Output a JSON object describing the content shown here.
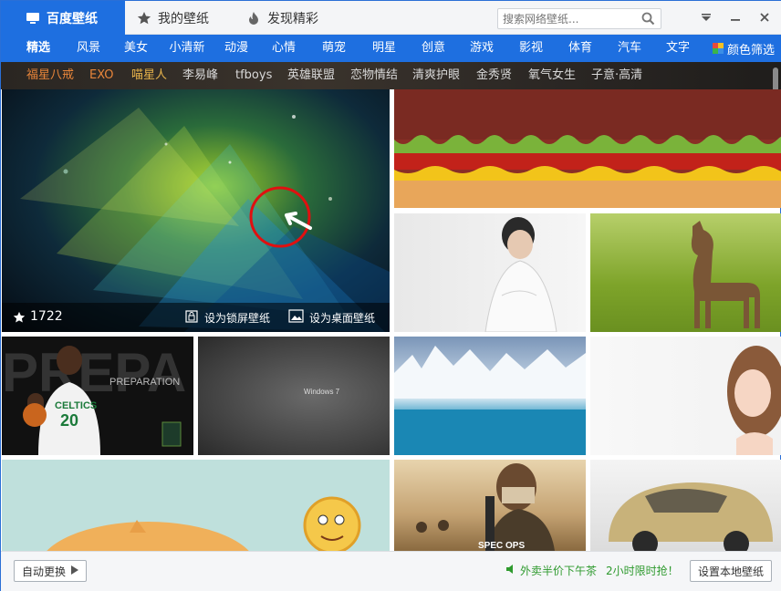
{
  "tabs": {
    "home": "百度壁纸",
    "mine": "我的壁纸",
    "discover": "发现精彩"
  },
  "search": {
    "placeholder": "搜索网络壁纸..."
  },
  "categories": [
    "精选",
    "风景",
    "美女",
    "小清新",
    "动漫",
    "心情",
    "萌宠",
    "明星",
    "创意",
    "游戏",
    "影视",
    "体育",
    "汽车",
    "文字"
  ],
  "color_filter": "颜色筛选",
  "tags": [
    "福星八戒",
    "EXO",
    "喵星人",
    "李易峰",
    "tfboys",
    "英雄联盟",
    "恋物情结",
    "清爽护眼",
    "金秀贤",
    "氧气女生",
    "子意·高清"
  ],
  "tag_colors": {
    "highlight1": "#e8853a",
    "highlight2": "#e7b34b",
    "normal": "#d9d9d9"
  },
  "featured": {
    "likes": "1722",
    "lock_label": "设为锁屏壁纸",
    "desktop_label": "设为桌面壁纸"
  },
  "tiles": {
    "win7_text": "Windows 7",
    "spec_ops_text": "SPEC OPS",
    "preparation_text": "PREPARATION",
    "celtics_text": "CELTICS",
    "jersey_number": "20"
  },
  "statusbar": {
    "auto_change": "自动更换",
    "promo": "外卖半价下午茶",
    "promo2": "2小时限时抢！",
    "set_local": "设置本地壁纸"
  },
  "colors": {
    "accent": "#1e6fe0",
    "promo_green": "#2e9a2e"
  }
}
